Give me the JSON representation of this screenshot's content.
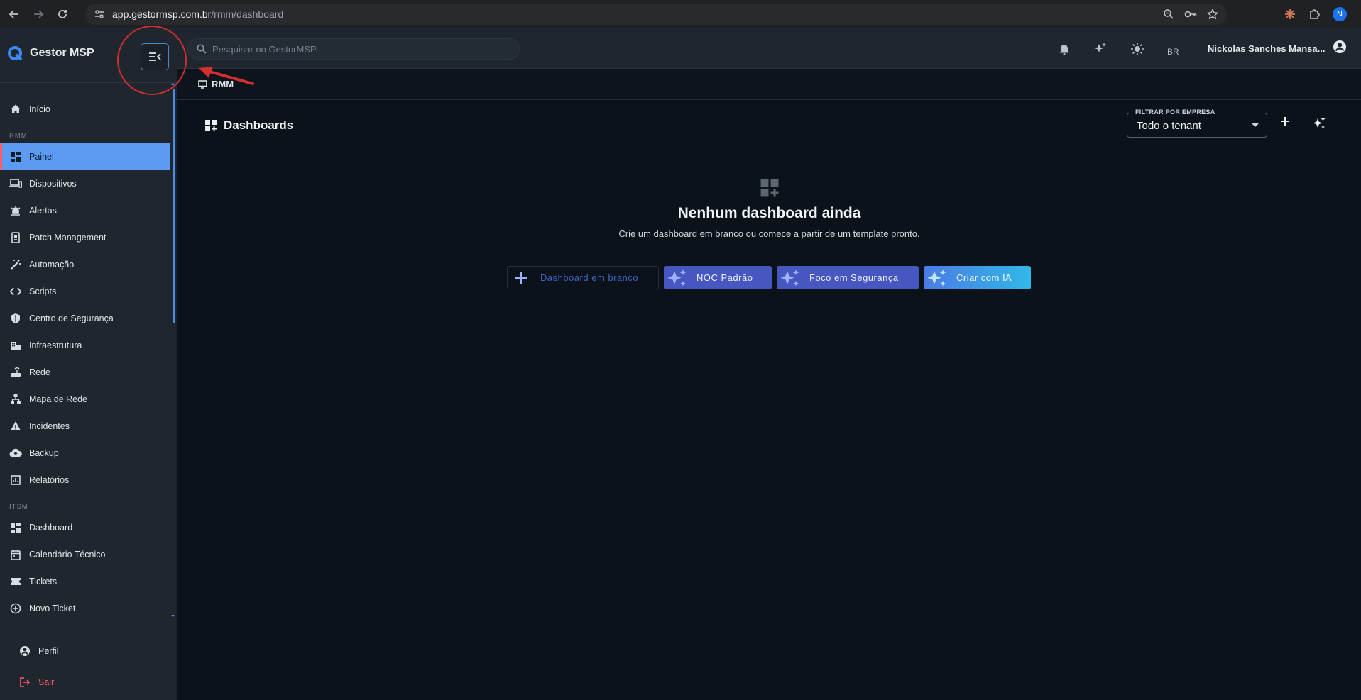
{
  "browser": {
    "url_host": "app.gestormsp.com.br",
    "url_path": "/rmm/dashboard",
    "profile_initial": "N"
  },
  "brand": {
    "name": "Gestor MSP"
  },
  "sidebar": {
    "top_item": {
      "label": "Início",
      "icon": "home-icon"
    },
    "sections": [
      {
        "title": "RMM",
        "items": [
          {
            "label": "Painel",
            "icon": "dashboard-icon",
            "active": true
          },
          {
            "label": "Dispositivos",
            "icon": "devices-icon"
          },
          {
            "label": "Alertas",
            "icon": "alarm-icon"
          },
          {
            "label": "Patch Management",
            "icon": "patch-icon"
          },
          {
            "label": "Automação",
            "icon": "wand-icon"
          },
          {
            "label": "Scripts",
            "icon": "code-icon"
          },
          {
            "label": "Centro de Segurança",
            "icon": "shield-icon"
          },
          {
            "label": "Infraestrutura",
            "icon": "building-icon"
          },
          {
            "label": "Rede",
            "icon": "router-icon"
          },
          {
            "label": "Mapa de Rede",
            "icon": "sitemap-icon"
          },
          {
            "label": "Incidentes",
            "icon": "warning-icon"
          },
          {
            "label": "Backup",
            "icon": "cloud-upload-icon"
          },
          {
            "label": "Relatórios",
            "icon": "report-icon"
          }
        ]
      },
      {
        "title": "ITSM",
        "items": [
          {
            "label": "Dashboard",
            "icon": "dashboard-icon"
          },
          {
            "label": "Calendário Técnico",
            "icon": "calendar-icon"
          },
          {
            "label": "Tickets",
            "icon": "ticket-icon"
          },
          {
            "label": "Novo Ticket",
            "icon": "add-circle-icon"
          }
        ]
      }
    ],
    "footer": {
      "profile_label": "Perfil",
      "logout_label": "Sair"
    }
  },
  "header": {
    "search_placeholder": "Pesquisar no GestorMSP...",
    "language": "BR",
    "user_name": "Nickolas Sanches Mansa..."
  },
  "breadcrumb": {
    "label": "RMM"
  },
  "main": {
    "title": "Dashboards",
    "filter": {
      "label": "FILTRAR POR EMPRESA",
      "value": "Todo o tenant"
    },
    "empty": {
      "title": "Nenhum dashboard ainda",
      "subtitle": "Crie um dashboard em branco ou comece a partir de um template pronto."
    },
    "actions": {
      "blank": "Dashboard em branco",
      "noc": "NOC Padrão",
      "security": "Foco em Segurança",
      "ai": "Criar com IA"
    }
  },
  "colors": {
    "accent": "#5b9cf2",
    "danger": "#ff5b6a",
    "annotation": "#d32f2f",
    "primary_button": "#4657c2"
  }
}
